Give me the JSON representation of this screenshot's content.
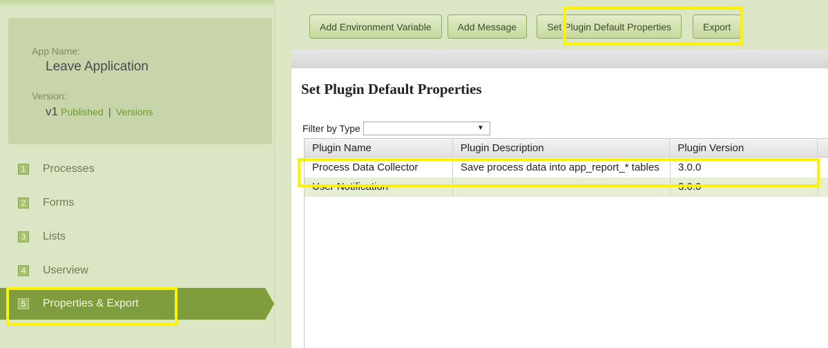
{
  "sidebar": {
    "app_name_label": "App Name:",
    "app_name": "Leave Application",
    "version_label": "Version:",
    "version": "v1",
    "published_link": "Published",
    "separator": "|",
    "versions_link": "Versions",
    "nav": [
      {
        "num": "1",
        "label": "Processes"
      },
      {
        "num": "2",
        "label": "Forms"
      },
      {
        "num": "3",
        "label": "Lists"
      },
      {
        "num": "4",
        "label": "Userview"
      },
      {
        "num": "5",
        "label": "Properties & Export"
      }
    ]
  },
  "toolbar": {
    "add_env_var": "Add Environment Variable",
    "add_message": "Add Message",
    "set_plugin_defaults": "Set Plugin Default Properties",
    "export": "Export"
  },
  "panel": {
    "title": "Set Plugin Default Properties",
    "filter_label": "Filter by Type",
    "filter_value": "",
    "caret": "▼"
  },
  "grid": {
    "headers": [
      "Plugin Name",
      "Plugin Description",
      "Plugin Version"
    ],
    "rows": [
      [
        "Process Data Collector",
        "Save process data into app_report_* tables",
        "3.0.0"
      ],
      [
        "User Notification",
        "",
        "3.0.0"
      ]
    ]
  },
  "colors": {
    "sidebar_bg": "#dbe7c4",
    "active_nav": "#7f9d3d",
    "highlight": "#fff200",
    "alt_row": "#e6efd3"
  }
}
